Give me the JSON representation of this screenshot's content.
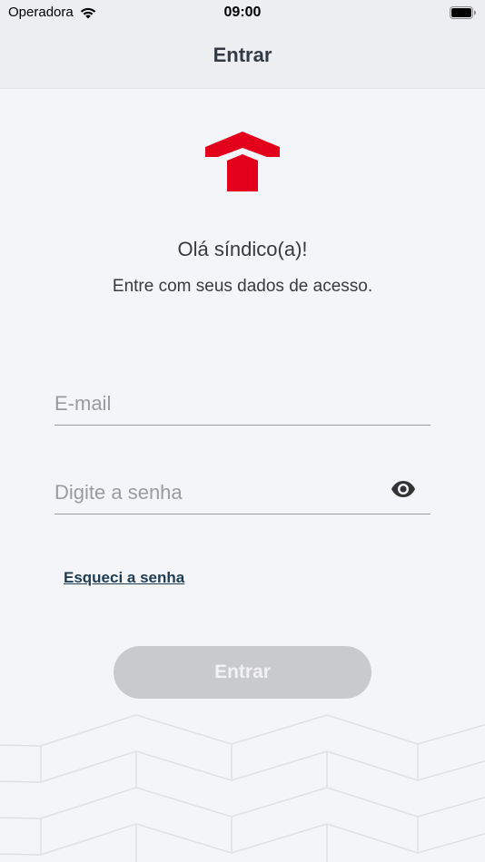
{
  "status_bar": {
    "carrier": "Operadora",
    "time": "09:00"
  },
  "nav": {
    "title": "Entrar"
  },
  "brand": {
    "logo_icon": "house-roof-logo",
    "accent_color": "#e2001a"
  },
  "welcome": {
    "greeting": "Olá síndico(a)!",
    "subtitle": "Entre com seus dados de acesso."
  },
  "form": {
    "email_placeholder": "E-mail",
    "email_value": "",
    "password_placeholder": "Digite a senha",
    "password_value": "",
    "toggle_icon": "eye-icon",
    "forgot_label": "Esqueci a senha",
    "submit_label": "Entrar",
    "submit_enabled": false
  }
}
